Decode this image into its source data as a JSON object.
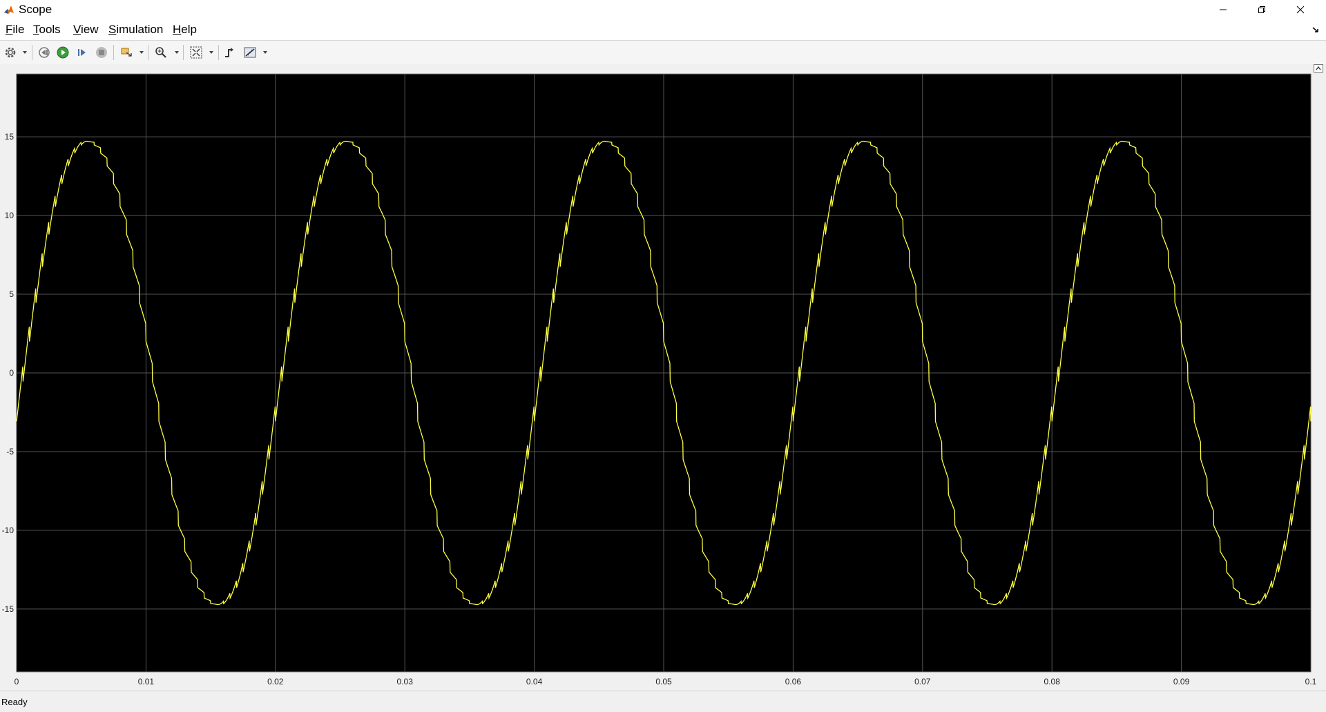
{
  "window": {
    "title": "Scope",
    "app_icon": "matlab-icon"
  },
  "menu": {
    "file": {
      "u": "F",
      "rest": "ile"
    },
    "tools": {
      "u": "T",
      "rest": "ools"
    },
    "view": {
      "u": "V",
      "rest": "iew"
    },
    "simulation": {
      "u": "S",
      "rest": "imulation"
    },
    "help": {
      "u": "H",
      "rest": "elp"
    }
  },
  "toolbar": {
    "icons": [
      "settings-icon",
      "step-back-icon",
      "run-icon",
      "step-forward-icon",
      "stop-icon",
      "highlight-simulink-block-icon",
      "zoom-icon",
      "scale-axes-icon",
      "triggers-icon",
      "measurements-icon"
    ]
  },
  "status": {
    "text": "Ready"
  },
  "colors": {
    "plot_bg": "#000000",
    "grid": "#555555",
    "trace": "#ffff44",
    "tick_text": "#c8c8c8"
  },
  "chart_data": {
    "type": "line",
    "title": "",
    "xlabel": "",
    "ylabel": "",
    "xlim": [
      0,
      0.1
    ],
    "ylim": [
      -19,
      19
    ],
    "grid": true,
    "legend": "none",
    "x_ticks": [
      0,
      0.01,
      0.02,
      0.03,
      0.04,
      0.05,
      0.06,
      0.07,
      0.08,
      0.09,
      0.1
    ],
    "x_tick_labels": [
      "0",
      "0.01",
      "0.02",
      "0.03",
      "0.04",
      "0.05",
      "0.06",
      "0.07",
      "0.08",
      "0.09",
      "0.1"
    ],
    "y_ticks": [
      15,
      10,
      5,
      0,
      -5,
      -10,
      -15
    ],
    "y_tick_labels": [
      "15",
      "10",
      "5",
      "0",
      "-5",
      "-10",
      "-15"
    ],
    "series": [
      {
        "description": "distorted sinusoid with switching ripple",
        "frequency_hz": 50,
        "peak_amplitude": 15.1,
        "peak_points": [
          [
            0.0055,
            15.0
          ],
          [
            0.0255,
            15.1
          ],
          [
            0.0455,
            15.1
          ],
          [
            0.0655,
            15.3
          ],
          [
            0.0855,
            15.3
          ]
        ],
        "trough_points": [
          [
            0.0155,
            -15.2
          ],
          [
            0.0355,
            -15.2
          ],
          [
            0.0555,
            -15.0
          ],
          [
            0.0755,
            -15.3
          ],
          [
            0.0955,
            -15.3
          ]
        ]
      }
    ]
  }
}
